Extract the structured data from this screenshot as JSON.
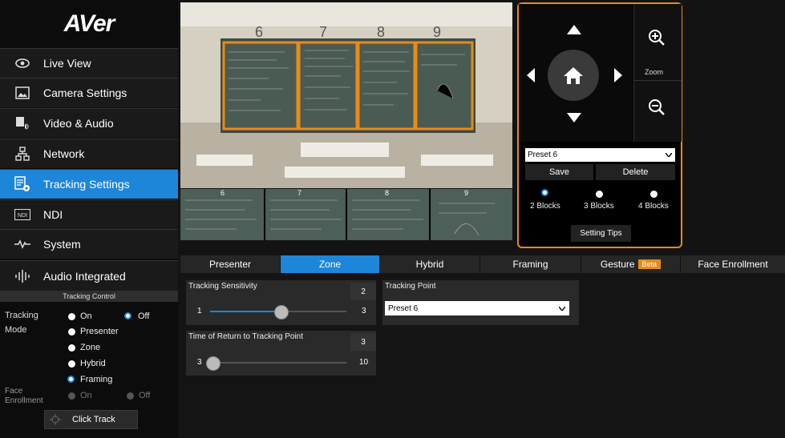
{
  "brand": {
    "logo": "AVer"
  },
  "sidebar": {
    "items": [
      {
        "label": "Live View"
      },
      {
        "label": "Camera Settings"
      },
      {
        "label": "Video & Audio"
      },
      {
        "label": "Network"
      },
      {
        "label": "Tracking Settings"
      },
      {
        "label": "NDI"
      },
      {
        "label": "System"
      },
      {
        "label": "Audio Integrated"
      }
    ]
  },
  "tracking_control": {
    "header": "Tracking Control",
    "tracking_label": "Tracking",
    "on_label": "On",
    "off_label": "Off",
    "mode_label": "Mode",
    "modes": [
      "Presenter",
      "Zone",
      "Hybrid",
      "Framing"
    ],
    "selected_mode": "Framing",
    "face_label_1": "Face",
    "face_label_2": "Enrollment",
    "face_on": "On",
    "face_off": "Off",
    "click_track": "Click Track"
  },
  "video": {
    "zone_numbers": [
      "6",
      "7",
      "8",
      "9"
    ],
    "thumb_numbers": [
      "6",
      "7",
      "8",
      "9"
    ]
  },
  "ptz": {
    "zoom_label": "Zoom",
    "preset_selected": "Preset 6",
    "save_label": "Save",
    "delete_label": "Delete",
    "blocks": [
      "2 Blocks",
      "3 Blocks",
      "4 Blocks"
    ],
    "selected_block": "2 Blocks",
    "setting_tips": "Setting Tips",
    "accent_color": "#e98b18"
  },
  "tabs": [
    {
      "label": "Presenter"
    },
    {
      "label": "Zone"
    },
    {
      "label": "Hybrid"
    },
    {
      "label": "Framing"
    },
    {
      "label": "Gesture",
      "badge": "Beta"
    },
    {
      "label": "Face Enrollment"
    }
  ],
  "zone_panel": {
    "sensitivity": {
      "title": "Tracking Sensitivity",
      "value": "2",
      "min": "1",
      "max": "3"
    },
    "return_time": {
      "title": "Time of Return to Tracking Point",
      "value": "3",
      "min": "3",
      "max": "10"
    },
    "tracking_point": {
      "title": "Tracking Point",
      "selected": "Preset 6"
    }
  },
  "colors": {
    "active_blue": "#1e86d8",
    "accent_orange": "#e98b18"
  }
}
